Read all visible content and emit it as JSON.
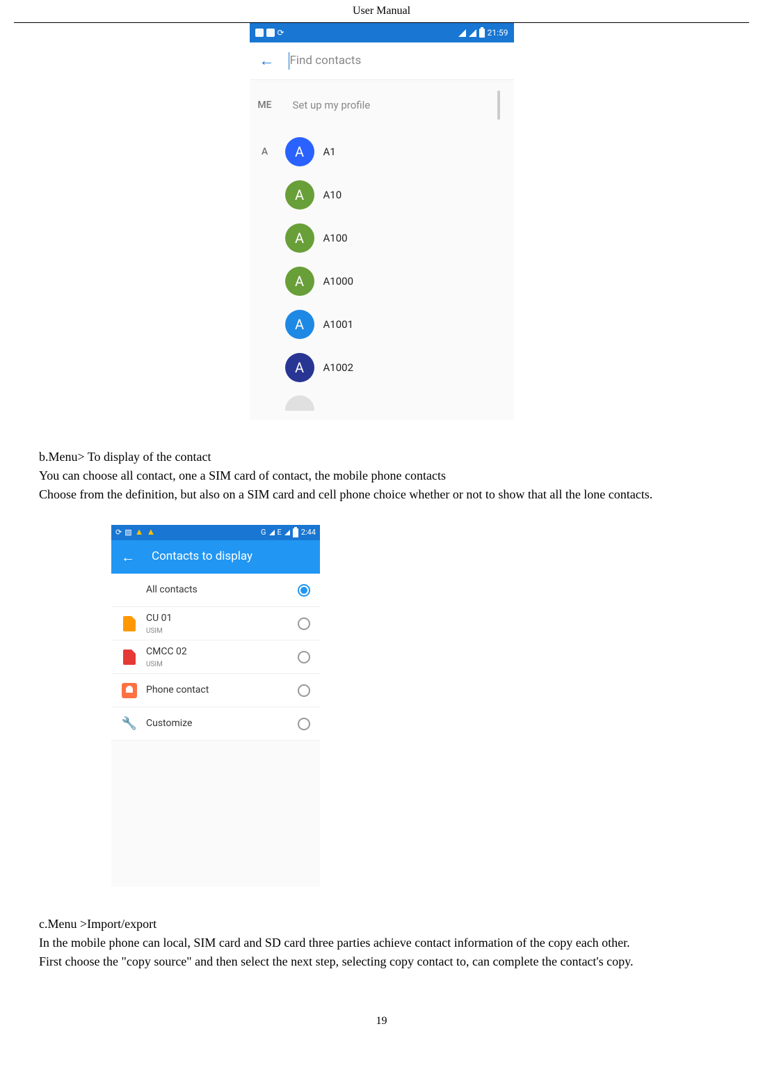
{
  "header": {
    "title": "User    Manual"
  },
  "footer": {
    "page": "19"
  },
  "screenshot1": {
    "status_time": "21:59",
    "search_placeholder": "Find contacts",
    "me_label": "ME",
    "me_setup": "Set up my profile",
    "section_letter": "A",
    "contacts": [
      {
        "name": "A1",
        "color": "blue"
      },
      {
        "name": "A10",
        "color": "green"
      },
      {
        "name": "A100",
        "color": "green"
      },
      {
        "name": "A1000",
        "color": "green"
      },
      {
        "name": "A1001",
        "color": "mblue"
      },
      {
        "name": "A1002",
        "color": "indigo"
      }
    ]
  },
  "text": {
    "b1": "b.Menu> To display of the contact",
    "b2": "You can choose all contact, one a SIM card of contact, the mobile phone contacts",
    "b3": "Choose from the definition, but also on a SIM card and cell phone choice whether or not to show      that all the lone contacts.",
    "c1": "c.Menu >Import/export",
    "c2": "In the mobile phone can local, SIM card and SD card three parties achieve contact information of the copy each other.",
    "c3": "First choose the \"copy source\" and then select the next step, selecting copy contact to, can complete the contact's copy."
  },
  "screenshot2": {
    "status_time": "2:44",
    "status_net": "G",
    "status_e": "E",
    "title": "Contacts to display",
    "options": [
      {
        "label": "All contacts",
        "sub": "",
        "icon": "none",
        "selected": true
      },
      {
        "label": "CU 01",
        "sub": "USIM",
        "icon": "sim-orange",
        "selected": false
      },
      {
        "label": "CMCC 02",
        "sub": "USIM",
        "icon": "sim-red",
        "selected": false
      },
      {
        "label": "Phone contact",
        "sub": "",
        "icon": "phone",
        "selected": false
      },
      {
        "label": "Customize",
        "sub": "",
        "icon": "wrench",
        "selected": false
      }
    ]
  }
}
